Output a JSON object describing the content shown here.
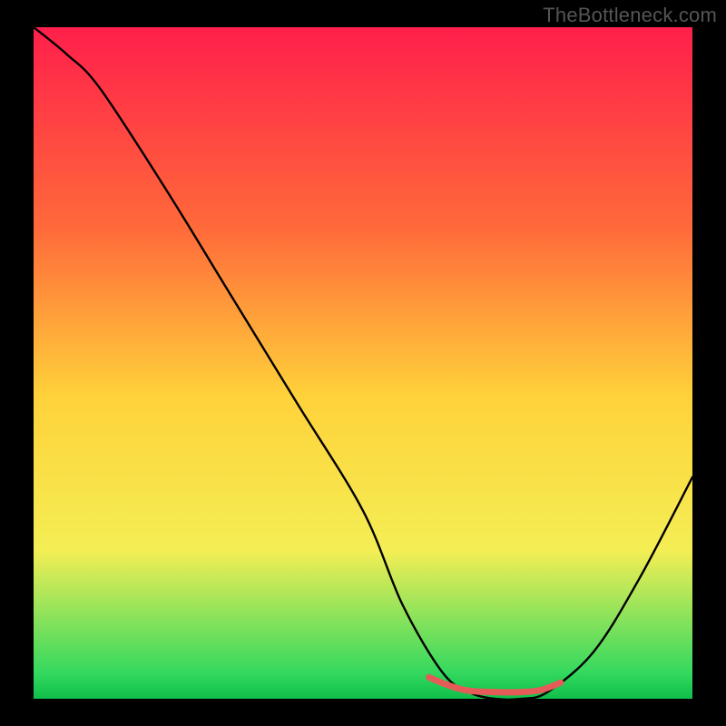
{
  "watermark": "TheBottleneck.com",
  "chart_data": {
    "type": "line",
    "title": "",
    "xlabel": "",
    "ylabel": "",
    "xlim": [
      0,
      100
    ],
    "ylim": [
      0,
      100
    ],
    "gradient_stops": [
      {
        "offset": 0,
        "color": "#ff1f4b"
      },
      {
        "offset": 30,
        "color": "#ff6a3a"
      },
      {
        "offset": 55,
        "color": "#ffd23a"
      },
      {
        "offset": 78,
        "color": "#f4ee55"
      },
      {
        "offset": 96,
        "color": "#35d95f"
      },
      {
        "offset": 100,
        "color": "#0fbf4a"
      }
    ],
    "series": [
      {
        "name": "bottleneck-curve",
        "color": "#000000",
        "x": [
          0,
          5,
          10,
          20,
          30,
          40,
          50,
          56,
          62,
          66,
          70,
          74,
          78,
          85,
          92,
          100
        ],
        "values": [
          100,
          96,
          91,
          76,
          60,
          44,
          28,
          14,
          4,
          1,
          0,
          0,
          1,
          7,
          18,
          33
        ]
      }
    ],
    "flat_highlight": {
      "comment": "red/coral segment over the plateau near the bottom",
      "color": "#e55b57",
      "x": [
        60,
        63,
        66,
        70,
        74,
        77,
        80
      ],
      "values": [
        3.2,
        2.0,
        1.2,
        1.0,
        1.0,
        1.3,
        2.4
      ]
    }
  }
}
